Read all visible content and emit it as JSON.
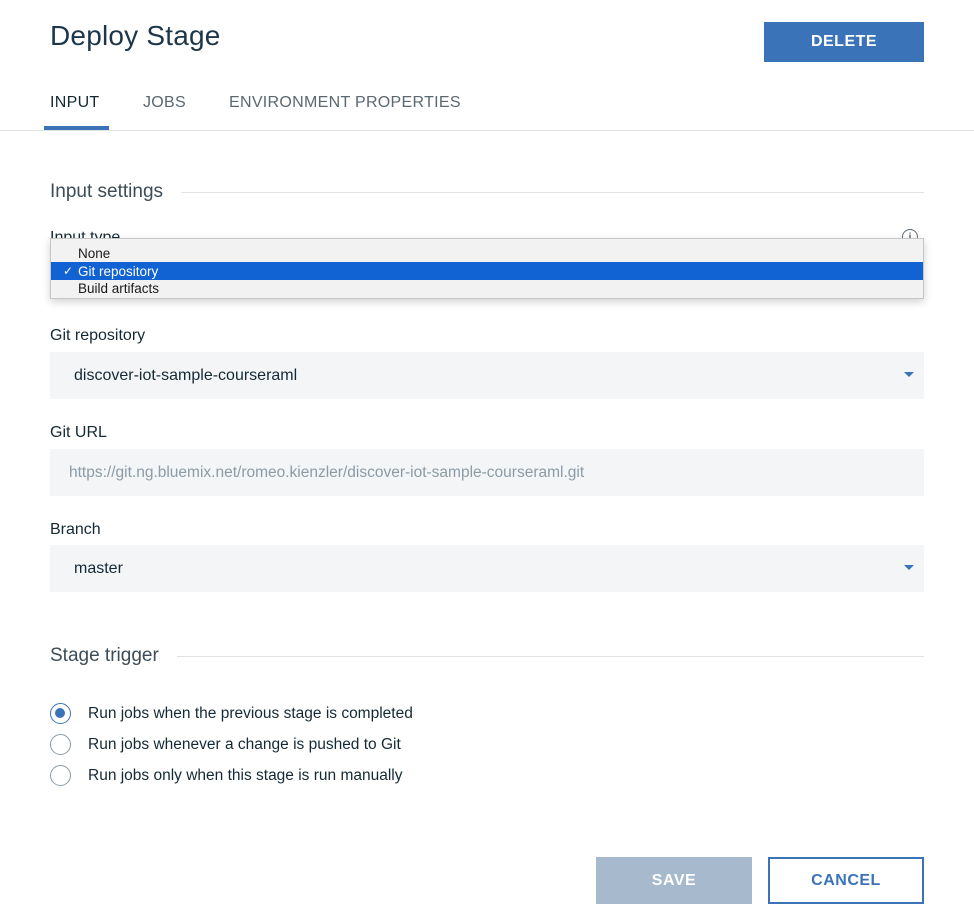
{
  "header": {
    "title": "Deploy Stage",
    "delete_label": "DELETE"
  },
  "tabs": [
    {
      "label": "INPUT",
      "active": true
    },
    {
      "label": "JOBS",
      "active": false
    },
    {
      "label": "ENVIRONMENT PROPERTIES",
      "active": false
    }
  ],
  "input_settings": {
    "heading": "Input settings",
    "input_type_label": "Input type",
    "input_type_options": [
      "None",
      "Git repository",
      "Build artifacts"
    ],
    "input_type_selected": "Git repository",
    "selected_check": "✓",
    "git_repository_label": "Git repository",
    "git_repository_value": "discover-iot-sample-courseraml",
    "git_url_label": "Git URL",
    "git_url_value": "https://git.ng.bluemix.net/romeo.kienzler/discover-iot-sample-courseraml.git",
    "branch_label": "Branch",
    "branch_value": "master"
  },
  "stage_trigger": {
    "heading": "Stage trigger",
    "options": [
      {
        "label": "Run jobs when the previous stage is completed",
        "checked": true
      },
      {
        "label": "Run jobs whenever a change is pushed to Git",
        "checked": false
      },
      {
        "label": "Run jobs only when this stage is run manually",
        "checked": false
      }
    ]
  },
  "footer": {
    "save_label": "SAVE",
    "cancel_label": "CANCEL"
  },
  "colors": {
    "accent": "#3b73b9",
    "selection": "#1162d3",
    "save_disabled": "#a7b9cc"
  }
}
